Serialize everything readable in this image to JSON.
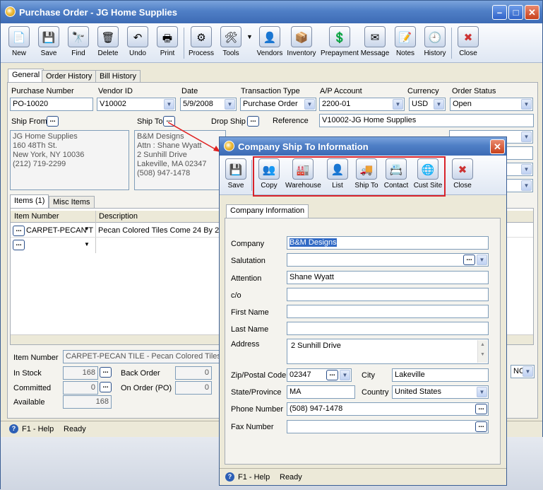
{
  "main_window": {
    "title": "Purchase Order - JG Home Supplies",
    "toolbar": [
      {
        "label": "New",
        "icon": "new-icon"
      },
      {
        "label": "Save",
        "icon": "save-icon"
      },
      {
        "label": "Find",
        "icon": "find-icon"
      },
      {
        "label": "Delete",
        "icon": "delete-icon"
      },
      {
        "label": "Undo",
        "icon": "undo-icon"
      },
      {
        "label": "Print",
        "icon": "print-icon"
      },
      {
        "label": "Process",
        "icon": "process-icon"
      },
      {
        "label": "Tools",
        "icon": "tools-icon"
      },
      {
        "label": "Vendors",
        "icon": "vendors-icon"
      },
      {
        "label": "Inventory",
        "icon": "inventory-icon"
      },
      {
        "label": "Prepayment",
        "icon": "prepayment-icon"
      },
      {
        "label": "Message",
        "icon": "message-icon"
      },
      {
        "label": "Notes",
        "icon": "notes-icon"
      },
      {
        "label": "History",
        "icon": "history-icon"
      },
      {
        "label": "Close",
        "icon": "close-icon"
      }
    ],
    "tabs": [
      "General",
      "Order History",
      "Bill History"
    ],
    "fields": {
      "purchase_number_label": "Purchase Number",
      "purchase_number": "PO-10020",
      "vendor_id_label": "Vendor ID",
      "vendor_id": "V10002",
      "date_label": "Date",
      "date": "5/9/2008",
      "transaction_type_label": "Transaction Type",
      "transaction_type": "Purchase Order",
      "ap_account_label": "A/P Account",
      "ap_account": "2200-01",
      "currency_label": "Currency",
      "currency": "USD",
      "order_status_label": "Order Status",
      "order_status": "Open",
      "ship_from_label": "Ship From",
      "ship_to_label": "Ship To",
      "drop_ship_label": "Drop Ship",
      "reference_label": "Reference",
      "reference": "V10002-JG Home Supplies",
      "ship_from_address": [
        "JG Home Supplies",
        "160 48Th St.",
        "New York, NY 10036",
        "(212) 719-2299"
      ],
      "ship_to_address": [
        "B&M Designs",
        "Attn : Shane Wyatt",
        "2 Sunhill Drive",
        "Lakeville, MA 02347",
        "(508) 947-1478"
      ]
    },
    "item_tabs": [
      "Items (1)",
      "Misc Items"
    ],
    "grid": {
      "headers": [
        "Item Number",
        "Description"
      ],
      "rows": [
        {
          "item": "CARPET-PECAN T",
          "description": "Pecan Colored Tiles Come 24 By 24"
        }
      ]
    },
    "bottom": {
      "item_number_label": "Item Number",
      "item_number": "CARPET-PECAN TILE - Pecan Colored Tiles Co",
      "in_stock_label": "In Stock",
      "in_stock": "168",
      "committed_label": "Committed",
      "committed": "0",
      "available_label": "Available",
      "available": "168",
      "back_order_label": "Back Order",
      "back_order": "0",
      "on_order_label": "On Order (PO)",
      "on_order": "0",
      "nc_value": "NC"
    },
    "status": {
      "help": "F1 - Help",
      "state": "Ready"
    }
  },
  "dialog": {
    "title": "Company Ship To Information",
    "toolbar": [
      {
        "label": "Save",
        "icon": "save-icon"
      },
      {
        "label": "Copy",
        "icon": "copy-icon"
      },
      {
        "label": "Warehouse",
        "icon": "warehouse-icon"
      },
      {
        "label": "List",
        "icon": "list-icon"
      },
      {
        "label": "Ship To",
        "icon": "ship-to-icon"
      },
      {
        "label": "Contact",
        "icon": "contact-icon"
      },
      {
        "label": "Cust Site",
        "icon": "cust-site-icon"
      },
      {
        "label": "Close",
        "icon": "close-icon"
      }
    ],
    "tab": "Company Information",
    "fields": {
      "company_label": "Company",
      "company": "B&M Designs",
      "salutation_label": "Salutation",
      "salutation": "",
      "attention_label": "Attention",
      "attention": "Shane Wyatt",
      "co_label": "c/o",
      "co": "",
      "first_name_label": "First Name",
      "first_name": "",
      "last_name_label": "Last Name",
      "last_name": "",
      "address_label": "Address",
      "address": "2 Sunhill Drive",
      "zip_label": "Zip/Postal Code",
      "zip": "02347",
      "city_label": "City",
      "city": "Lakeville",
      "state_label": "State/Province",
      "state": "MA",
      "country_label": "Country",
      "country": "United States",
      "phone_label": "Phone Number",
      "phone": "(508) 947-1478",
      "fax_label": "Fax Number",
      "fax": ""
    },
    "status": {
      "help": "F1 - Help",
      "state": "Ready"
    }
  }
}
